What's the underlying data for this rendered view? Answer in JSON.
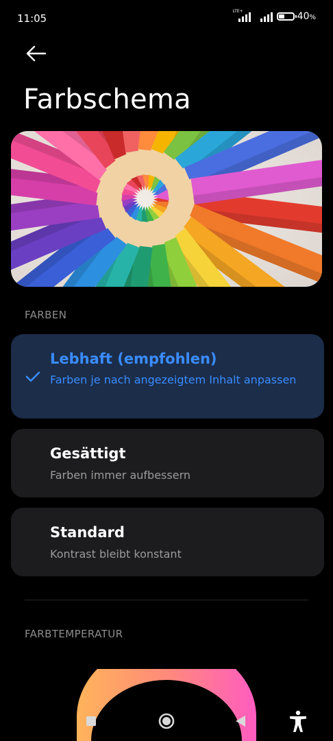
{
  "status_bar": {
    "time": "11:05",
    "network_tag": "LTE+",
    "battery_percent": "40",
    "battery_suffix": "%",
    "battery_level": 0.4
  },
  "header": {
    "back_icon": "arrow-left-icon",
    "title": "Farbschema"
  },
  "hero": {
    "image": "colored-pencils-circle-image"
  },
  "colors_section": {
    "label": "FARBEN",
    "options": [
      {
        "title": "Lebhaft (empfohlen)",
        "description": "Farben je nach angezeigtem Inhalt anpassen",
        "selected": true
      },
      {
        "title": "Gesättigt",
        "description": "Farben immer aufbessern",
        "selected": false
      },
      {
        "title": "Standard",
        "description": "Kontrast bleibt konstant",
        "selected": false
      }
    ]
  },
  "temperature_section": {
    "label": "FARBTEMPERATUR"
  },
  "nav_bar": {
    "recents_icon": "square-icon",
    "home_icon": "circle-icon",
    "back_icon": "triangle-back-icon",
    "accessibility_icon": "accessibility-icon"
  },
  "colors": {
    "accent": "#3a8cff",
    "selected_card": "#1b2d49",
    "card": "#1c1c1e",
    "background": "#000000"
  }
}
